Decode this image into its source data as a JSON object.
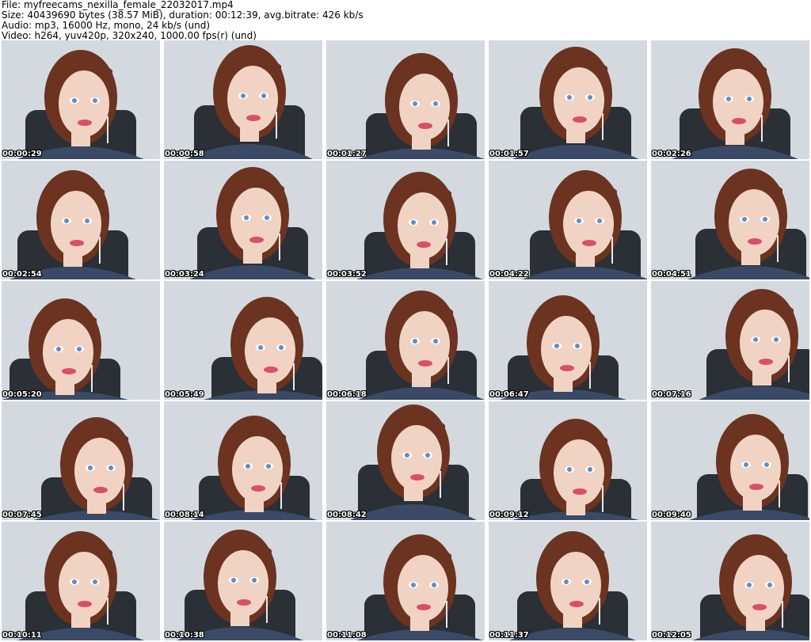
{
  "header": {
    "file": "File: myfreecams_nexilla_female_22032017.mp4",
    "size": "Size: 40439690 bytes (38.57 MiB), duration: 00:12:39, avg.bitrate: 426 kb/s",
    "audio": "Audio: mp3, 16000 Hz, mono, 24 kb/s (und)",
    "video": "Video: h264, yuv420p, 320x240, 1000.00 fps(r) (und)"
  },
  "thumbnails": [
    {
      "timestamp": "00:00:29"
    },
    {
      "timestamp": "00:00:58"
    },
    {
      "timestamp": "00:01:27"
    },
    {
      "timestamp": "00:01:57"
    },
    {
      "timestamp": "00:02:26"
    },
    {
      "timestamp": "00:02:54"
    },
    {
      "timestamp": "00:03:24"
    },
    {
      "timestamp": "00:03:52"
    },
    {
      "timestamp": "00:04:22"
    },
    {
      "timestamp": "00:04:51"
    },
    {
      "timestamp": "00:05:20"
    },
    {
      "timestamp": "00:05:49"
    },
    {
      "timestamp": "00:06:18"
    },
    {
      "timestamp": "00:06:47"
    },
    {
      "timestamp": "00:07:16"
    },
    {
      "timestamp": "00:07:45"
    },
    {
      "timestamp": "00:08:14"
    },
    {
      "timestamp": "00:08:42"
    },
    {
      "timestamp": "00:09:12"
    },
    {
      "timestamp": "00:09:40"
    },
    {
      "timestamp": "00:10:11"
    },
    {
      "timestamp": "00:10:38"
    },
    {
      "timestamp": "00:11:08"
    },
    {
      "timestamp": "00:11:37"
    },
    {
      "timestamp": "00:12:05"
    }
  ],
  "colors": {
    "wall": "#d3d9df",
    "chair": "#2b2f36",
    "hair": "#6b3320",
    "skin": "#f1d3c4",
    "shirt": "#3a4a66",
    "lips": "#d94f6a",
    "eyes": "#5e8fc4"
  }
}
